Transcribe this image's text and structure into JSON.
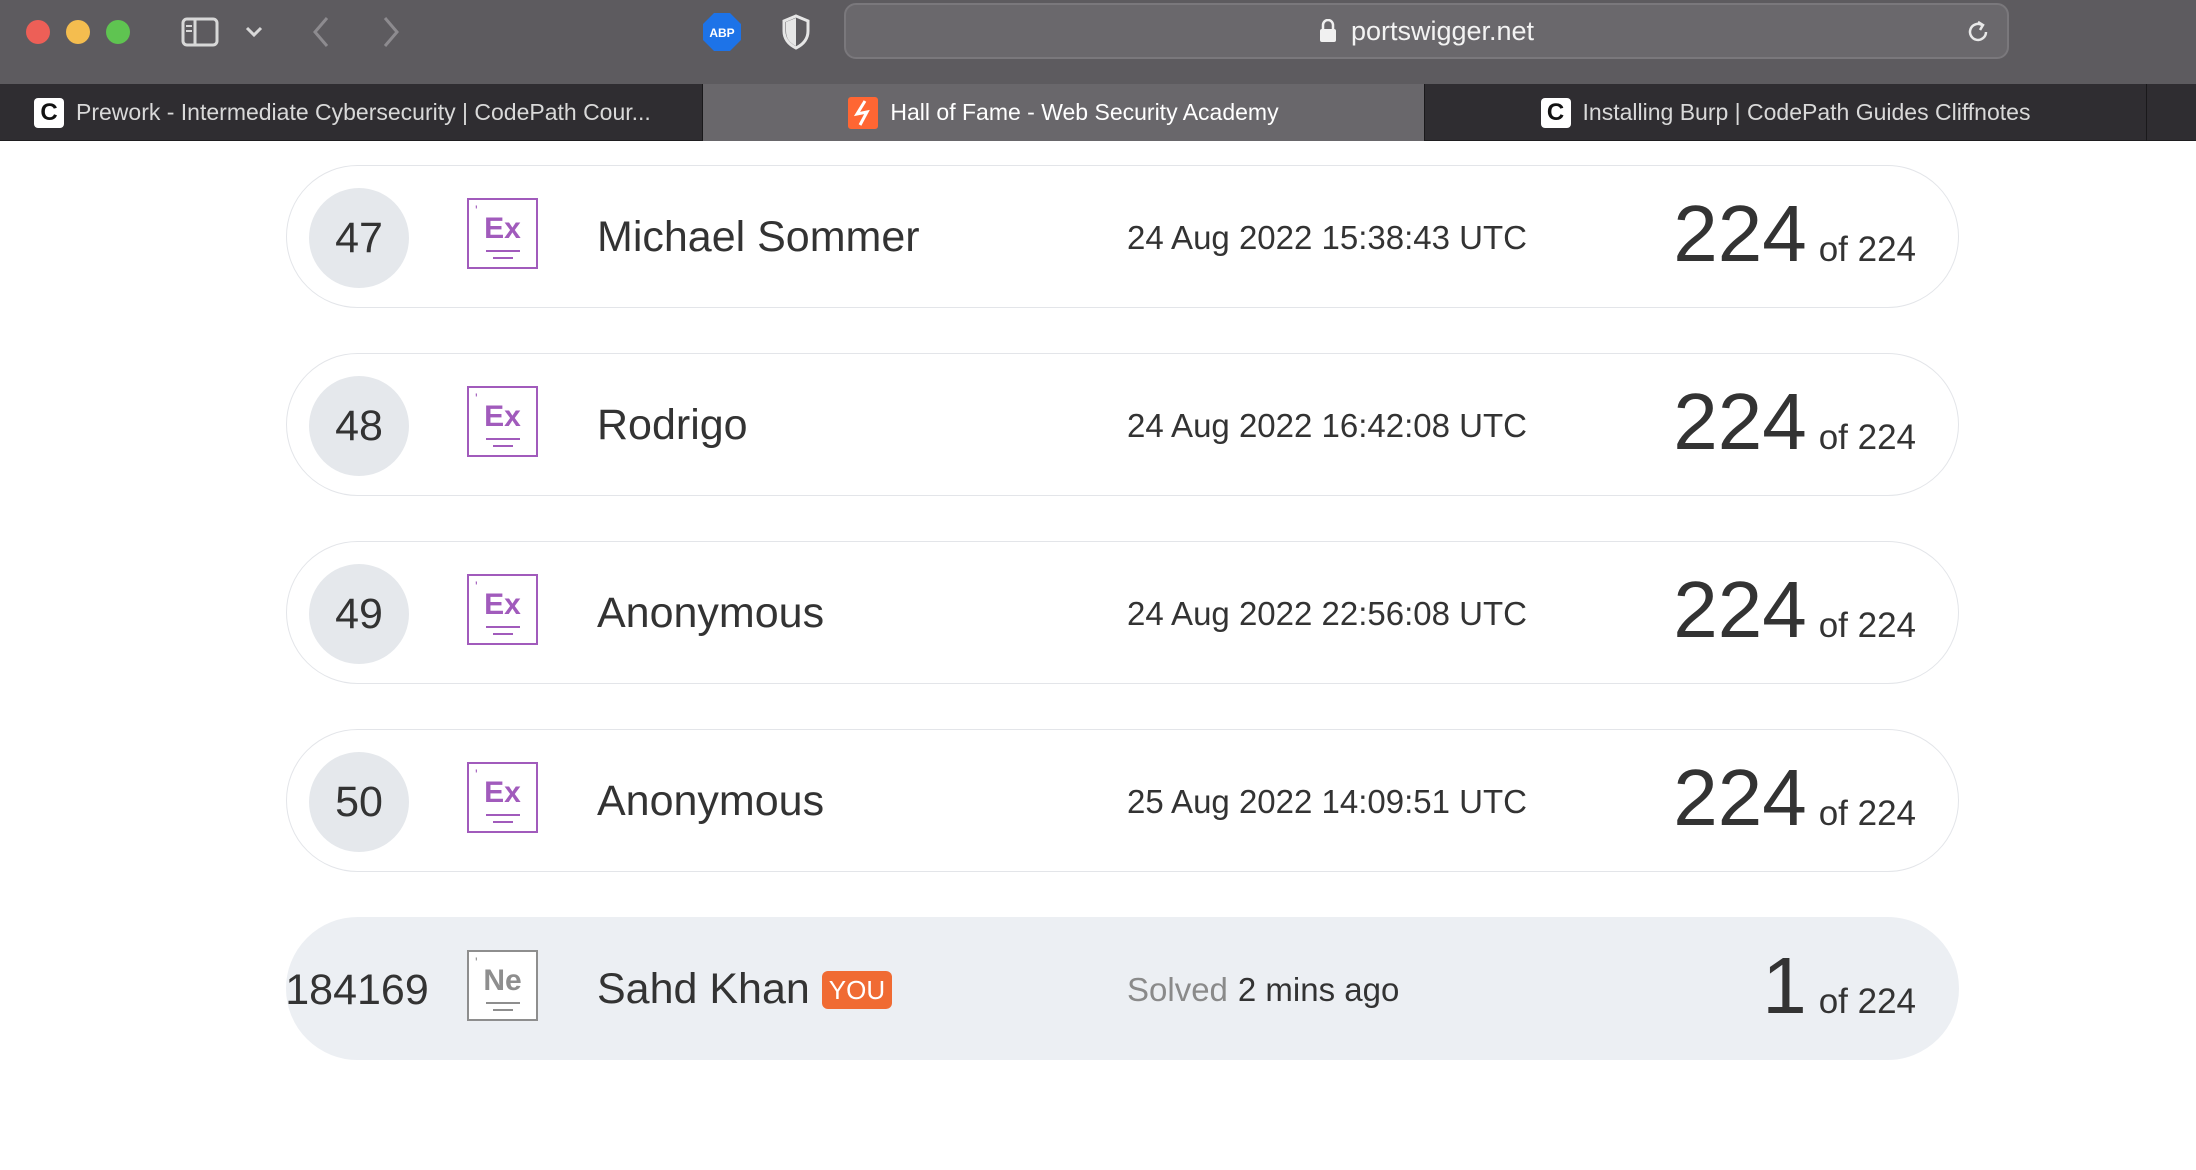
{
  "browser": {
    "url": "portswigger.net",
    "abp_label": "ABP",
    "tabs": [
      {
        "title": "Prework - Intermediate Cybersecurity | CodePath Cour...",
        "favicon": "codepath-icon",
        "active": false
      },
      {
        "title": "Hall of Fame - Web Security Academy",
        "favicon": "portswigger-icon",
        "active": true
      },
      {
        "title": "Installing Burp | CodePath Guides Cliffnotes",
        "favicon": "codepath-icon",
        "active": false
      }
    ],
    "codepath_glyph": "C"
  },
  "leaderboard": {
    "rows": [
      {
        "rank": "47",
        "badge": "Ex",
        "name": "Michael Sommer",
        "date": "24 Aug 2022 15:38:43 UTC",
        "score": "224",
        "of": "of 224"
      },
      {
        "rank": "48",
        "badge": "Ex",
        "name": "Rodrigo",
        "date": "24 Aug 2022 16:42:08 UTC",
        "score": "224",
        "of": "of 224"
      },
      {
        "rank": "49",
        "badge": "Ex",
        "name": "Anonymous",
        "date": "24 Aug 2022 22:56:08 UTC",
        "score": "224",
        "of": "of 224"
      },
      {
        "rank": "50",
        "badge": "Ex",
        "name": "Anonymous",
        "date": "25 Aug 2022 14:09:51 UTC",
        "score": "224",
        "of": "of 224"
      }
    ],
    "me": {
      "rank": "184169",
      "badge": "Ne",
      "name": "Sahd Khan",
      "you_label": "YOU",
      "solved_label": "Solved",
      "solved_time": "2 mins ago",
      "score": "1",
      "of": "of 224"
    },
    "colors": {
      "expert_badge": "#a15bbc",
      "novice_badge": "#8e8e8e",
      "you_badge": "#f06b33"
    }
  }
}
